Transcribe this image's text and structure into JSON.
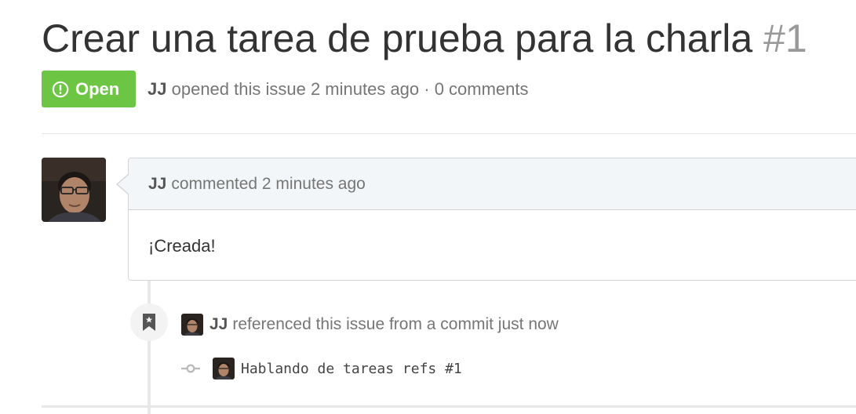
{
  "issue": {
    "title": "Crear una tarea de prueba para la charla",
    "number": "#1",
    "state": "Open",
    "state_color": "#6cc644",
    "author": "JJ",
    "meta_text": "opened this issue 2 minutes ago · 0 comments"
  },
  "comment": {
    "author": "JJ",
    "meta": "commented 2 minutes ago",
    "body": "¡Creada!"
  },
  "events": [
    {
      "icon": "bookmark-icon",
      "author": "JJ",
      "text": "referenced this issue from a commit just now",
      "commit": {
        "icon": "git-commit-icon",
        "message": "Hablando de tareas refs #1"
      }
    }
  ]
}
